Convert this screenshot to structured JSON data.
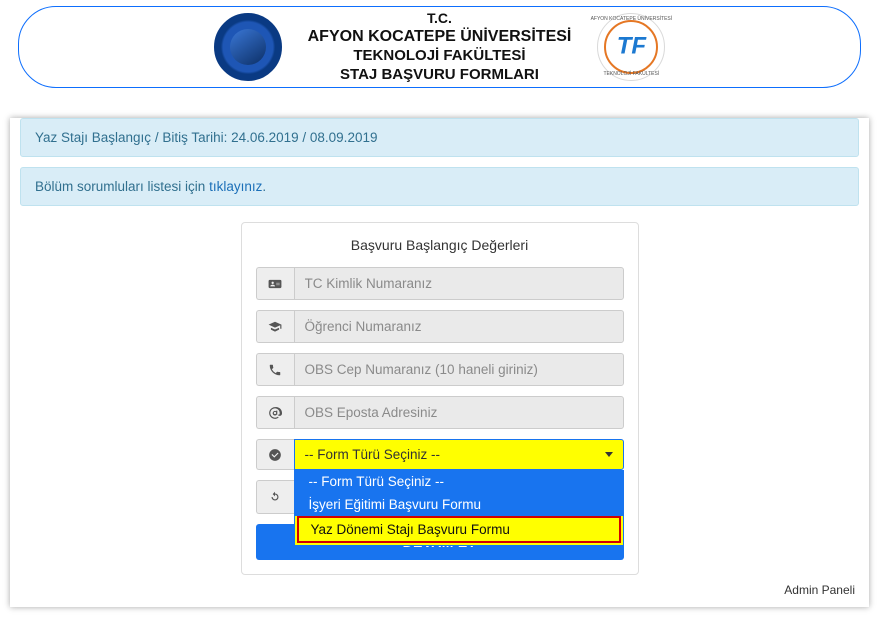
{
  "header": {
    "line1": "T.C.",
    "line2": "AFYON KOCATEPE ÜNİVERSİTESİ",
    "line3": "TEKNOLOJİ FAKÜLTESİ",
    "line4": "STAJ BAŞVURU FORMLARI",
    "right_logo_top": "AFYON KOCATEPE ÜNİVERSİTESİ",
    "right_logo_bottom": "TEKNOLOJİ FAKÜLTESİ",
    "right_logo_center": "TF"
  },
  "alerts": {
    "dates": "Yaz Stajı Başlangıç / Bitiş Tarihi: 24.06.2019 / 08.09.2019",
    "responsibles_prefix": "Bölüm sorumluları listesi için ",
    "responsibles_link": "tıklayınız",
    "responsibles_suffix": "."
  },
  "form": {
    "title": "Başvuru Başlangıç Değerleri",
    "fields": {
      "tc_placeholder": "TC Kimlik Numaranız",
      "ogrno_placeholder": "Öğrenci Numaranız",
      "cep_placeholder": "OBS Cep Numaranız (10 haneli giriniz)",
      "eposta_placeholder": "OBS Eposta Adresiniz"
    },
    "select": {
      "current": "-- Form Türü Seçiniz --",
      "options": [
        "-- Form Türü Seçiniz --",
        "İşyeri Eğitimi Başvuru Formu",
        "Yaz Dönemi Stajı Başvuru Formu"
      ]
    },
    "submit": "DEVAM ET"
  },
  "footer": {
    "admin": "Admin Paneli"
  }
}
